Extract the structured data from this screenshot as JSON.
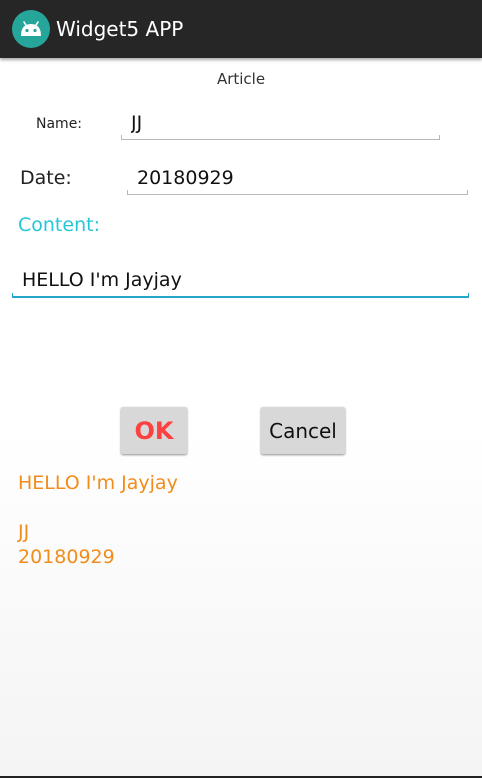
{
  "app": {
    "title": "Widget5 APP",
    "icon": "android-icon",
    "bar_color": "#262626",
    "icon_color": "#26a69a"
  },
  "form": {
    "heading": "Article",
    "name_label": "Name:",
    "name_value": "JJ",
    "date_label": "Date:",
    "date_value": "20180929",
    "content_label": "Content:",
    "content_value": "HELLO I'm Jayjay",
    "accent_color": "#26c6da"
  },
  "buttons": {
    "ok_label": "OK",
    "ok_color": "#ff4040",
    "cancel_label": "Cancel"
  },
  "output": {
    "content": "HELLO I'm Jayjay",
    "name": "JJ",
    "date": "20180929",
    "color": "#f28c1a"
  }
}
